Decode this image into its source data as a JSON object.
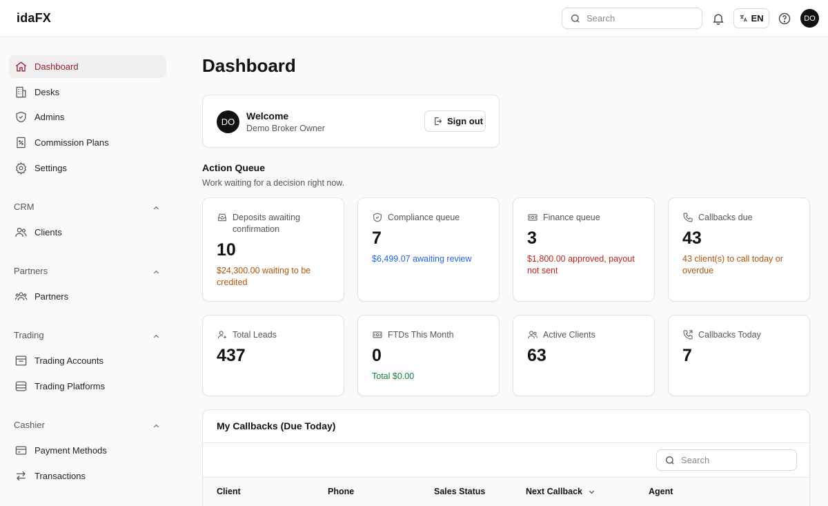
{
  "app": {
    "brand": "idaFX"
  },
  "topbar": {
    "search_placeholder": "Search",
    "language": "EN",
    "user_initials": "DO"
  },
  "sidebar": {
    "items": [
      {
        "label": "Dashboard",
        "icon": "home-icon",
        "active": true
      },
      {
        "label": "Desks",
        "icon": "building-icon"
      },
      {
        "label": "Admins",
        "icon": "shield-icon"
      },
      {
        "label": "Commission Plans",
        "icon": "percent-doc-icon"
      },
      {
        "label": "Settings",
        "icon": "gear-icon"
      }
    ],
    "sections": [
      {
        "title": "CRM",
        "items": [
          {
            "label": "Clients",
            "icon": "users-icon"
          }
        ]
      },
      {
        "title": "Partners",
        "items": [
          {
            "label": "Partners",
            "icon": "group-icon"
          }
        ]
      },
      {
        "title": "Trading",
        "items": [
          {
            "label": "Trading Accounts",
            "icon": "browser-icon"
          },
          {
            "label": "Trading Platforms",
            "icon": "server-icon"
          }
        ]
      },
      {
        "title": "Cashier",
        "items": [
          {
            "label": "Payment Methods",
            "icon": "card-icon"
          },
          {
            "label": "Transactions",
            "icon": "arrows-icon"
          }
        ]
      }
    ]
  },
  "main": {
    "title": "Dashboard",
    "welcome": {
      "initials": "DO",
      "heading": "Welcome",
      "subtitle": "Demo Broker Owner",
      "signout_label": "Sign out"
    },
    "action_queue": {
      "title": "Action Queue",
      "subtitle": "Work waiting for a decision right now.",
      "cards": [
        {
          "label": "Deposits awaiting confirmation",
          "value": "10",
          "note": "$24,300.00 waiting to be credited",
          "note_color": "#b45309",
          "icon": "inbox-icon"
        },
        {
          "label": "Compliance queue",
          "value": "7",
          "note": "$6,499.07 awaiting review",
          "note_color": "#2563eb",
          "icon": "shield-check-icon"
        },
        {
          "label": "Finance queue",
          "value": "3",
          "note": "$1,800.00 approved, payout not sent",
          "note_color": "#c81e1e",
          "icon": "banknote-icon"
        },
        {
          "label": "Callbacks due",
          "value": "43",
          "note": "43 client(s) to call today or overdue",
          "note_color": "#b45309",
          "icon": "phone-icon"
        }
      ]
    },
    "stats": [
      {
        "label": "Total Leads",
        "value": "437",
        "icon": "user-plus-icon"
      },
      {
        "label": "FTDs This Month",
        "value": "0",
        "note": "Total $0.00",
        "note_color": "#15803d",
        "icon": "banknote-icon"
      },
      {
        "label": "Active Clients",
        "value": "63",
        "icon": "users-icon"
      },
      {
        "label": "Callbacks Today",
        "value": "7",
        "icon": "phone-outgoing-icon"
      }
    ],
    "callbacks": {
      "title": "My Callbacks (Due Today)",
      "search_placeholder": "Search",
      "columns": [
        "Client",
        "Phone",
        "Sales Status",
        "Next Callback",
        "Agent"
      ]
    }
  }
}
